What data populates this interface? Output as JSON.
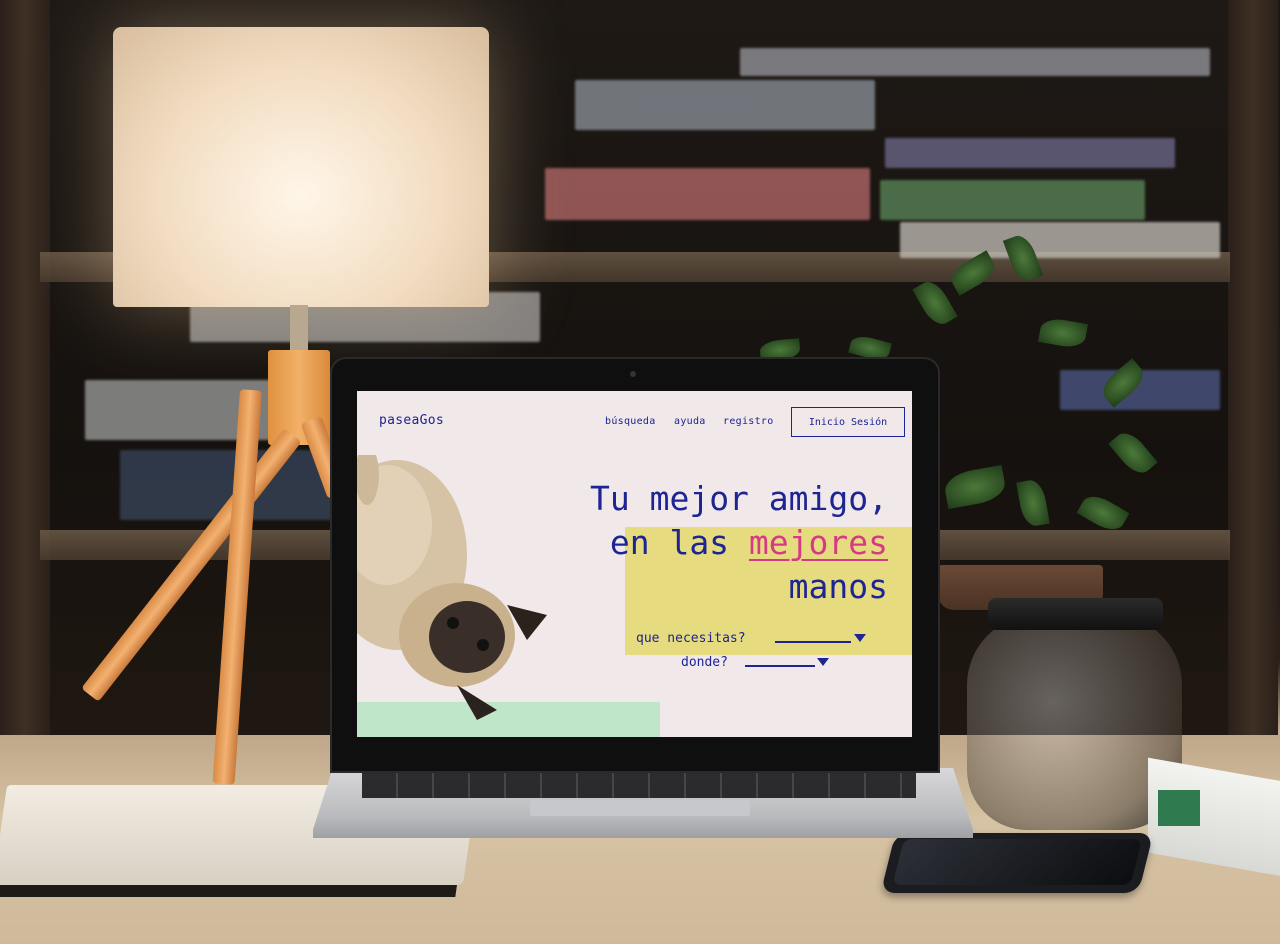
{
  "website": {
    "logo": "paseaGos",
    "nav": {
      "search": "búsqueda",
      "help": "ayuda",
      "register": "registro",
      "login": "Inicio Sesión"
    },
    "headline": {
      "line1": "Tu mejor amigo,",
      "line2_prefix": "en las ",
      "line2_accent": "mejores",
      "line3": "manos"
    },
    "query_what": "que necesitas?",
    "query_where": "donde?",
    "colors": {
      "primary": "#1d2493",
      "accent": "#d63a84",
      "highlight": "#e6dc7f",
      "background": "#f1e8ea",
      "strip": "#bfe6c8"
    },
    "icons": [
      "dropdown-triangle-icon"
    ]
  }
}
